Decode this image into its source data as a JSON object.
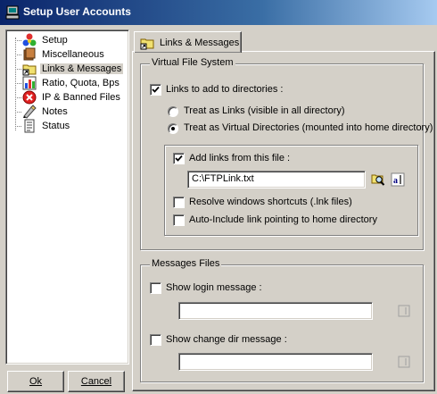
{
  "window": {
    "title": "Setup User Accounts",
    "icon": "computer-icon"
  },
  "tree": {
    "items": [
      {
        "label": "Setup",
        "icon": "setup-icon"
      },
      {
        "label": "Miscellaneous",
        "icon": "miscellaneous-icon"
      },
      {
        "label": "Links & Messages",
        "icon": "folder-link-icon",
        "selected": true
      },
      {
        "label": "Ratio, Quota, Bps",
        "icon": "ratio-icon"
      },
      {
        "label": "IP & Banned Files",
        "icon": "banned-icon"
      },
      {
        "label": "Notes",
        "icon": "notes-icon"
      },
      {
        "label": "Status",
        "icon": "status-icon"
      }
    ]
  },
  "buttons": {
    "ok": "Ok",
    "cancel": "Cancel"
  },
  "tab": {
    "label": "Links & Messages",
    "icon": "folder-link-icon"
  },
  "vfs": {
    "legend": "Virtual File System",
    "links_to_add": {
      "label": "Links to add to directories :",
      "checked": true
    },
    "radio_links": {
      "label": "Treat as Links (visible in all directory)",
      "selected": false
    },
    "radio_virtual": {
      "label": "Treat as Virtual Directories (mounted into home directory)",
      "selected": true
    },
    "add_links_file": {
      "label": "Add links from this file :",
      "checked": true
    },
    "file_path": "C:\\FTPLink.txt",
    "browse_icon": "browse-search-icon",
    "edit_icon": "edit-text-icon",
    "resolve_shortcuts": {
      "label": "Resolve windows shortcuts (.lnk files)",
      "checked": false
    },
    "auto_include": {
      "label": "Auto-Include link pointing to home directory",
      "checked": false
    }
  },
  "messages": {
    "legend": "Messages Files",
    "show_login": {
      "label": "Show login message :",
      "checked": false,
      "value": ""
    },
    "show_change_dir": {
      "label": "Show change dir message :",
      "checked": false,
      "value": ""
    }
  },
  "colors": {
    "titlebar_start": "#0a246a",
    "titlebar_end": "#a6caf0",
    "face": "#d4d0c8"
  }
}
